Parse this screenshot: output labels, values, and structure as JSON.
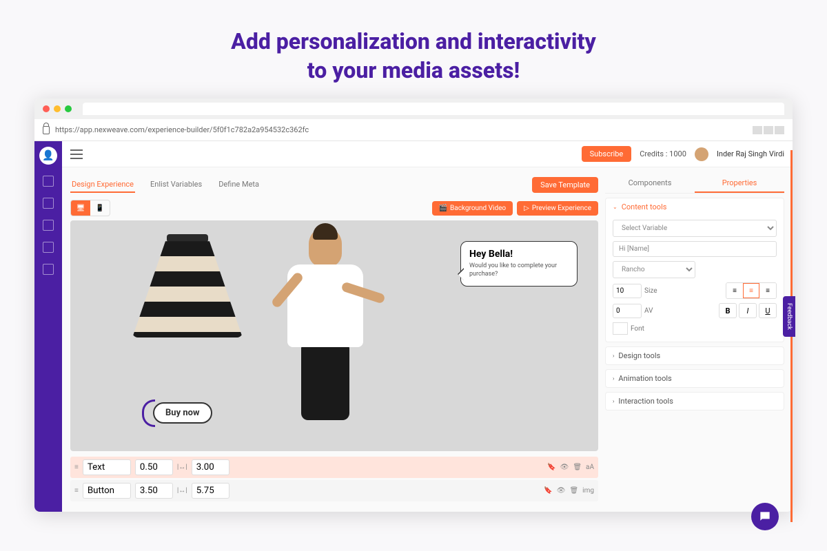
{
  "hero": {
    "line1": "Add personalization and interactivity",
    "line2": "to your media assets!"
  },
  "browser": {
    "url": "https://app.nexweave.com/experience-builder/5f0f1c782a2a954532c362fc"
  },
  "topbar": {
    "subscribe": "Subscribe",
    "credits_label": "Credits : 1000",
    "user_name": "Inder Raj Singh Virdi"
  },
  "tabs": {
    "design": "Design Experience",
    "enlist": "Enlist Variables",
    "meta": "Define Meta",
    "save": "Save Template"
  },
  "toolbar": {
    "bg_video": "Background Video",
    "preview": "Preview Experience"
  },
  "canvas": {
    "buy_now": "Buy now",
    "bubble_title": "Hey Bella!",
    "bubble_body": "Would you like to complete your purchase?"
  },
  "timeline": {
    "rows": [
      {
        "label": "Text",
        "start": "0.50",
        "end": "3.00",
        "tag": "aA"
      },
      {
        "label": "Button",
        "start": "3.50",
        "end": "5.75",
        "tag": "img"
      }
    ]
  },
  "panel": {
    "tab_components": "Components",
    "tab_properties": "Properties",
    "sections": {
      "content": "Content tools",
      "design": "Design tools",
      "animation": "Animation tools",
      "interaction": "Interaction tools"
    },
    "select_variable": "Select Variable",
    "text_value": "Hi [Name]",
    "font_family": "Rancho",
    "font_size": "10",
    "size_label": "Size",
    "letter_spacing": "0",
    "font_label": "Font"
  },
  "feedback": "Feedback"
}
